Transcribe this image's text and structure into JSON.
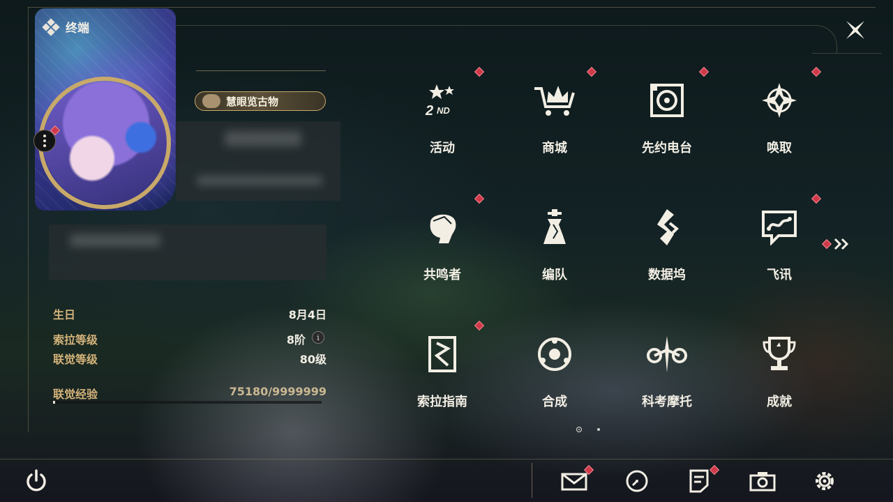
{
  "header": {
    "title": "终端"
  },
  "profile": {
    "title_badge": "慧眼览古物",
    "stats": [
      {
        "label": "生日",
        "value": "8月4日"
      },
      {
        "label": "索拉等级",
        "value": "8阶"
      },
      {
        "label": "联觉等级",
        "value": "80级"
      }
    ],
    "xp": {
      "label": "联觉经验",
      "value": "75180/9999999",
      "fraction": 0.0075
    }
  },
  "menu": [
    {
      "label": "活动",
      "icon": "events-icon",
      "badge": true
    },
    {
      "label": "商城",
      "icon": "shop-crown-cart-icon",
      "badge": true
    },
    {
      "label": "先约电台",
      "icon": "radio-icon",
      "badge": true
    },
    {
      "label": "唤取",
      "icon": "convene-compass-icon",
      "badge": true
    },
    {
      "label": "共鸣者",
      "icon": "resonator-head-icon",
      "badge": true
    },
    {
      "label": "编队",
      "icon": "chess-team-icon",
      "badge": false
    },
    {
      "label": "数据坞",
      "icon": "data-bank-icon",
      "badge": false
    },
    {
      "label": "飞讯",
      "icon": "chat-message-icon",
      "badge": true
    },
    {
      "label": "索拉指南",
      "icon": "guidebook-icon",
      "badge": true
    },
    {
      "label": "合成",
      "icon": "synthesis-icon",
      "badge": false
    },
    {
      "label": "科考摩托",
      "icon": "motorbike-icon",
      "badge": false
    },
    {
      "label": "成就",
      "icon": "trophy-icon",
      "badge": false
    }
  ],
  "pagination": {
    "current": 1,
    "total": 2
  },
  "colors": {
    "accent": "#c9a96a",
    "badge_red": "#d0394a",
    "label_gold": "#d4b37a"
  }
}
